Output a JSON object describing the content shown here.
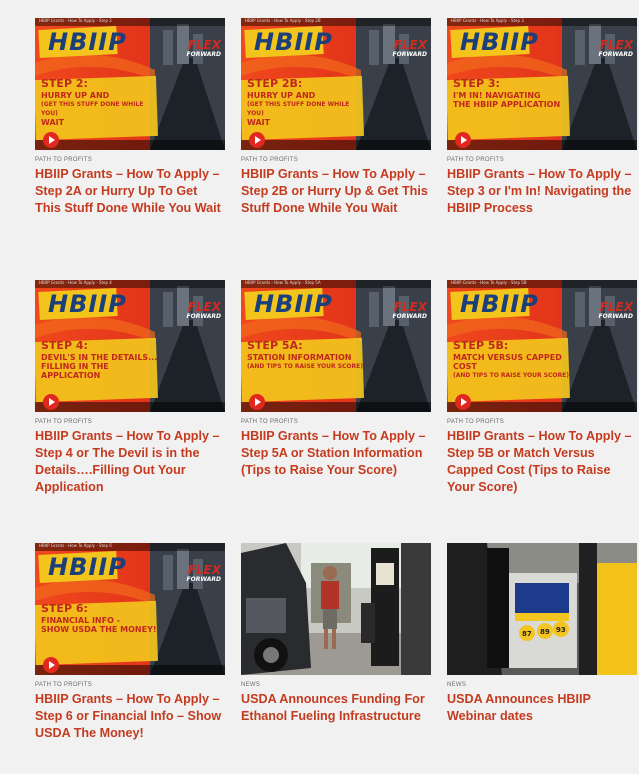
{
  "cards": [
    {
      "kicker": "PATH TO PROFITS",
      "title": "HBIIP Grants – How To Apply – Step 2A or Hurry Up To Get This Stuff Done While You Wait",
      "thumb": {
        "kind": "video",
        "brand": "HBIIP",
        "logo": "FLEX",
        "logo_sub": "FORWARD",
        "step": "STEP 2:",
        "line2": "HURRY UP AND",
        "line3": "(GET THIS STUFF DONE WHILE YOU)",
        "line4": "WAIT",
        "yt": "HBIIP Grants - How To Apply - Step 2"
      }
    },
    {
      "kicker": "PATH TO PROFITS",
      "title": "HBIIP Grants – How To Apply – Step 2B or Hurry Up & Get This Stuff Done While You Wait",
      "thumb": {
        "kind": "video",
        "brand": "HBIIP",
        "logo": "FLEX",
        "logo_sub": "FORWARD",
        "step": "STEP 2B:",
        "line2": "HURRY UP AND",
        "line3": "(GET THIS STUFF DONE WHILE YOU)",
        "line4": "WAIT",
        "yt": "HBIIP Grants - How To Apply - Step 2B"
      }
    },
    {
      "kicker": "PATH TO PROFITS",
      "title": "HBIIP Grants – How To Apply – Step 3 or I'm In! Navigating the HBIIP Process",
      "thumb": {
        "kind": "video",
        "brand": "HBIIP",
        "logo": "FLEX",
        "logo_sub": "FORWARD",
        "step": "STEP 3:",
        "line2": "I'M IN! NAVIGATING",
        "line3": "THE HBIIP APPLICATION",
        "line4": "",
        "yt": "HBIIP Grants - How To Apply - Step 3"
      }
    },
    {
      "kicker": "PATH TO PROFITS",
      "title": "HBIIP Grants – How To Apply – Step 4 or The Devil is in the Details….Filling Out Your Application",
      "thumb": {
        "kind": "video",
        "brand": "HBIIP",
        "logo": "FLEX",
        "logo_sub": "FORWARD",
        "step": "STEP 4:",
        "line2": "DEVIL'S IN THE DETAILS...",
        "line3": "FILLING IN THE APPLICATION",
        "line4": "",
        "yt": "HBIIP Grants - How To Apply - Step 4"
      }
    },
    {
      "kicker": "PATH TO PROFITS",
      "title": "HBIIP Grants – How To Apply – Step 5A or Station Information (Tips to Raise Your Score)",
      "thumb": {
        "kind": "video",
        "brand": "HBIIP",
        "logo": "FLEX",
        "logo_sub": "FORWARD",
        "step": "STEP 5A:",
        "line2": "STATION INFORMATION",
        "line3": "(AND TIPS TO RAISE YOUR SCORE)",
        "line4": "",
        "yt": "HBIIP Grants - How To Apply - Step 5A"
      }
    },
    {
      "kicker": "PATH TO PROFITS",
      "title": "HBIIP Grants – How To Apply – Step 5B or Match Versus Capped Cost (Tips to Raise Your Score)",
      "thumb": {
        "kind": "video",
        "brand": "HBIIP",
        "logo": "FLEX",
        "logo_sub": "FORWARD",
        "step": "STEP 5B:",
        "line2": "MATCH VERSUS CAPPED COST",
        "line3": "(AND TIPS TO RAISE YOUR SCORE)",
        "line4": "",
        "yt": "HBIIP Grants - How To Apply - Step 5B"
      }
    },
    {
      "kicker": "PATH TO PROFITS",
      "title": "HBIIP Grants – How To Apply – Step 6 or Financial Info – Show USDA The Money!",
      "thumb": {
        "kind": "video",
        "brand": "HBIIP",
        "logo": "FLEX",
        "logo_sub": "FORWARD",
        "step": "STEP 6:",
        "line2": "FINANCIAL INFO -",
        "line3": "SHOW USDA THE MONEY!",
        "line4": "",
        "yt": "HBIIP Grants - How To Apply - Step 6"
      }
    },
    {
      "kicker": "NEWS",
      "title": "USDA Announces Funding For Ethanol Fueling Infrastructure",
      "thumb": {
        "kind": "photo-station"
      }
    },
    {
      "kicker": "NEWS",
      "title": "USDA Announces HBIIP Webinar dates",
      "thumb": {
        "kind": "photo-pump"
      }
    }
  ],
  "colors": {
    "title": "#c53b1f",
    "kicker": "#6b6b6b",
    "background": "#f1f1f1",
    "banner_yellow": "#f2c41c",
    "play_red": "#e0281f"
  }
}
